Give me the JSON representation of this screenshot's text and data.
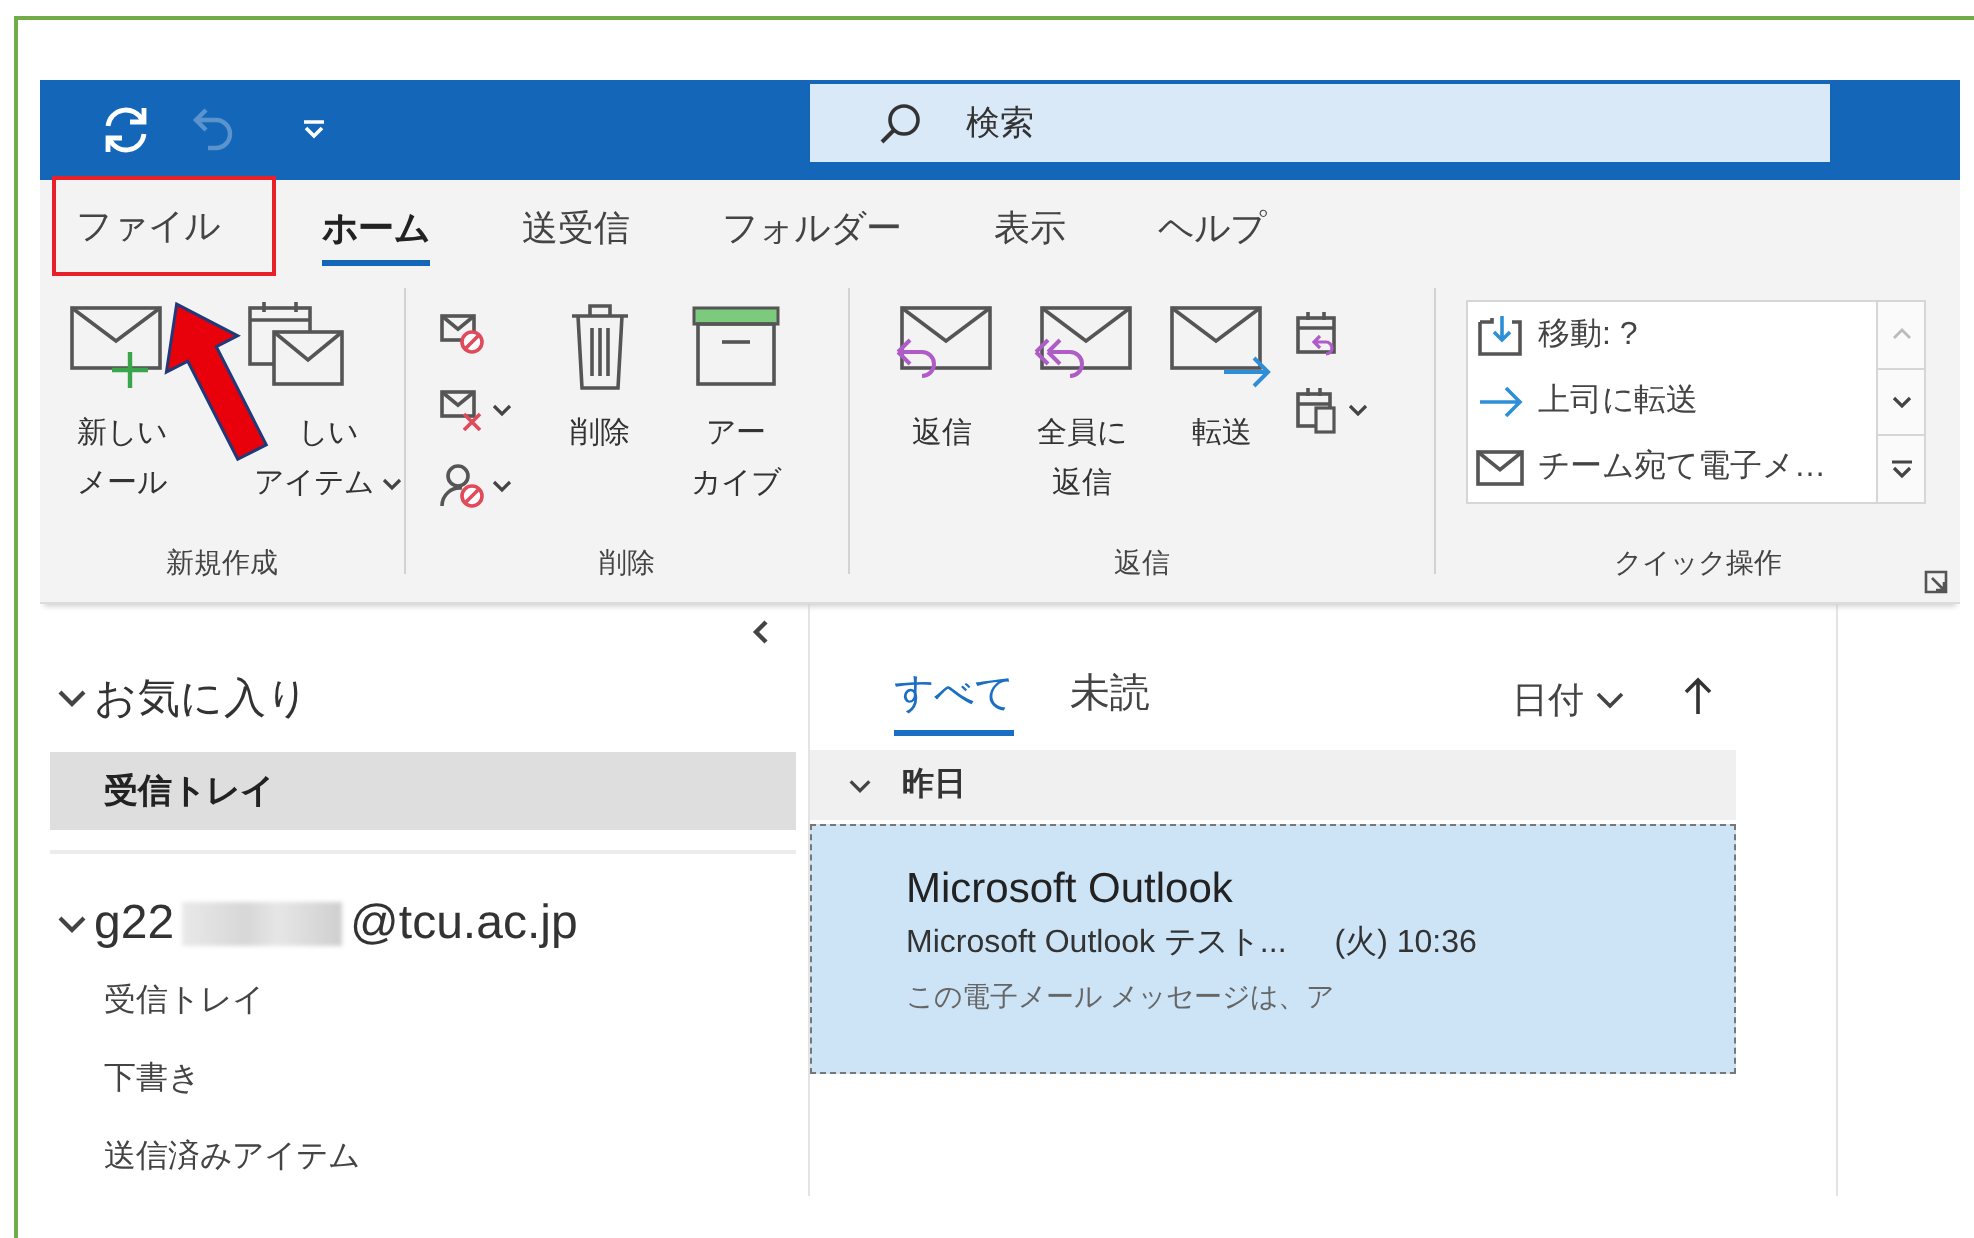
{
  "quick_access": {
    "undo": {
      "disabled": true
    }
  },
  "search": {
    "placeholder": "検索"
  },
  "tabs": [
    {
      "label": "ファイル",
      "selected": false,
      "highlighted": true
    },
    {
      "label": "ホーム",
      "selected": true,
      "highlighted": false
    },
    {
      "label": "送受信",
      "selected": false,
      "highlighted": false
    },
    {
      "label": "フォルダー",
      "selected": false,
      "highlighted": false
    },
    {
      "label": "表示",
      "selected": false,
      "highlighted": false
    },
    {
      "label": "ヘルプ",
      "selected": false,
      "highlighted": false
    }
  ],
  "ribbon": {
    "groups": [
      {
        "label": "新規作成",
        "buttons": [
          {
            "lines": [
              "新しい",
              "メール"
            ],
            "dropdown": false
          },
          {
            "lines": [
              "しい",
              "アイテム"
            ],
            "dropdown": true
          }
        ]
      },
      {
        "label": "削除",
        "buttons": [
          {
            "lines": [
              "削除"
            ],
            "dropdown": false
          },
          {
            "lines": [
              "アー",
              "カイブ"
            ],
            "dropdown": false
          }
        ]
      },
      {
        "label": "返信",
        "buttons": [
          {
            "lines": [
              "返信"
            ],
            "dropdown": false
          },
          {
            "lines": [
              "全員に",
              "返信"
            ],
            "dropdown": false
          },
          {
            "lines": [
              "転送"
            ],
            "dropdown": false
          }
        ]
      },
      {
        "label": "クイック操作",
        "quick_steps": [
          "移動: ?",
          "上司に転送",
          "チーム宛て電子メ…"
        ]
      }
    ]
  },
  "folder_pane": {
    "favorites": {
      "label": "お気に入り",
      "expanded": true,
      "folders": [
        {
          "label": "受信トレイ",
          "selected": true
        }
      ]
    },
    "account": {
      "name": "g22",
      "domain": "@tcu.ac.jp",
      "expanded": true,
      "folders": [
        {
          "label": "受信トレイ",
          "selected": false
        },
        {
          "label": "下書き",
          "selected": false
        },
        {
          "label": "送信済みアイテム",
          "selected": false
        }
      ]
    }
  },
  "message_list": {
    "filters": [
      {
        "label": "すべて",
        "selected": true
      },
      {
        "label": "未読",
        "selected": false
      }
    ],
    "sort": "日付",
    "groups": [
      {
        "label": "昨日",
        "expanded": true,
        "messages": [
          {
            "sender": "Microsoft Outlook",
            "subject": "Microsoft Outlook テスト...",
            "time": "(火) 10:36",
            "preview": "この電子メール メッセージは、ア",
            "selected": true
          }
        ]
      }
    ]
  }
}
